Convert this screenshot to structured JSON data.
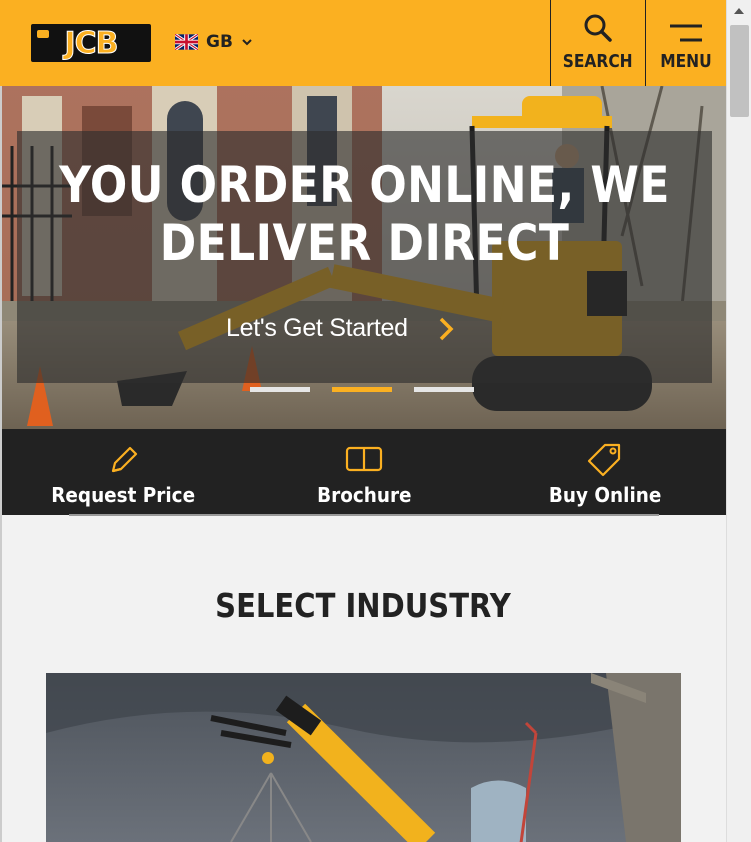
{
  "header": {
    "logo_text": "JCB",
    "region_label": "GB",
    "search_label": "SEARCH",
    "menu_label": "MENU",
    "brand_color": "#fbb021"
  },
  "hero": {
    "title": "YOU ORDER ONLINE, WE DELIVER DIRECT",
    "cta_label": "Let's Get Started",
    "active_slide": 2,
    "slide_count": 3
  },
  "actions": [
    {
      "label": "Request Price",
      "icon": "pencil-icon"
    },
    {
      "label": "Brochure",
      "icon": "brochure-icon"
    },
    {
      "label": "Buy Online",
      "icon": "tag-icon"
    }
  ],
  "main": {
    "section_title": "SELECT INDUSTRY"
  }
}
